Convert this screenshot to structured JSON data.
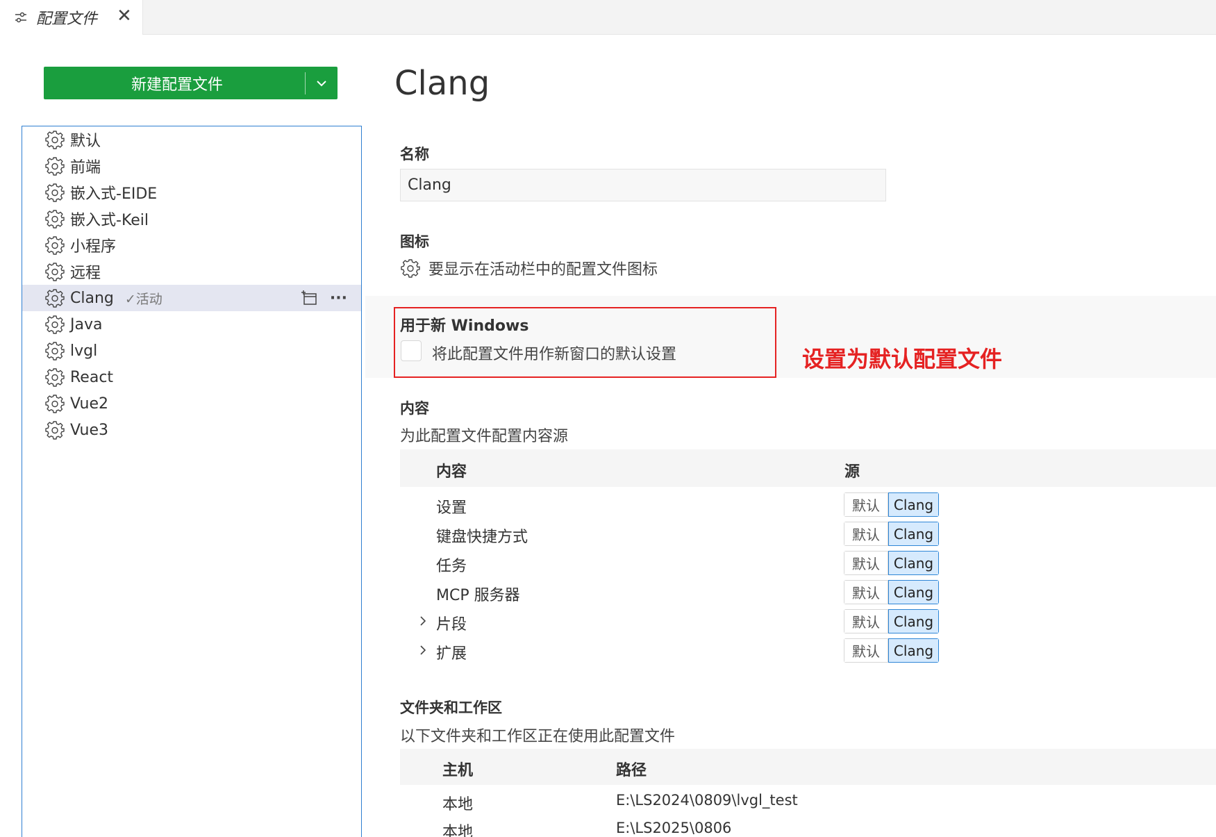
{
  "tab": {
    "label": "配置文件",
    "close": "✕"
  },
  "left": {
    "new_button": "新建配置文件",
    "profiles": [
      {
        "label": "默认"
      },
      {
        "label": "前端"
      },
      {
        "label": "嵌入式-EIDE"
      },
      {
        "label": "嵌入式-Keil"
      },
      {
        "label": "小程序"
      },
      {
        "label": "远程"
      },
      {
        "label": "Clang",
        "active_badge": "✓活动"
      },
      {
        "label": "Java"
      },
      {
        "label": "lvgl"
      },
      {
        "label": "React"
      },
      {
        "label": "Vue2"
      },
      {
        "label": "Vue3"
      }
    ],
    "more_actions": "···"
  },
  "main": {
    "title": "Clang",
    "name": {
      "label": "名称",
      "value": "Clang"
    },
    "icon": {
      "label": "图标",
      "desc": "要显示在活动栏中的配置文件图标"
    },
    "default_windows": {
      "label": "用于新 Windows",
      "checkbox_label": "将此配置文件用作新窗口的默认设置",
      "checked": false
    },
    "annotation": "设置为默认配置文件",
    "content": {
      "label": "内容",
      "desc": "为此配置文件配置内容源",
      "col_content": "内容",
      "col_source": "源",
      "rows": [
        {
          "label": "设置",
          "expandable": false,
          "opt_default": "默认",
          "opt_profile": "Clang",
          "selected": "Clang"
        },
        {
          "label": "键盘快捷方式",
          "expandable": false,
          "opt_default": "默认",
          "opt_profile": "Clang",
          "selected": "Clang"
        },
        {
          "label": "任务",
          "expandable": false,
          "opt_default": "默认",
          "opt_profile": "Clang",
          "selected": "Clang"
        },
        {
          "label": "MCP 服务器",
          "expandable": false,
          "opt_default": "默认",
          "opt_profile": "Clang",
          "selected": "Clang"
        },
        {
          "label": "片段",
          "expandable": true,
          "opt_default": "默认",
          "opt_profile": "Clang",
          "selected": "Clang"
        },
        {
          "label": "扩展",
          "expandable": true,
          "opt_default": "默认",
          "opt_profile": "Clang",
          "selected": "Clang"
        }
      ]
    },
    "folders": {
      "label": "文件夹和工作区",
      "desc": "以下文件夹和工作区正在使用此配置文件",
      "col_host": "主机",
      "col_path": "路径",
      "rows": [
        {
          "host": "本地",
          "path": "E:\\LS2024\\0809\\lvgl_test"
        },
        {
          "host": "本地",
          "path": "E:\\LS2025\\0806"
        }
      ]
    }
  },
  "colors": {
    "primary_button": "#1a9e3e",
    "selection_border": "#2f7fd1",
    "annotation": "#e52222",
    "segment_selected": "#d6eafd"
  }
}
